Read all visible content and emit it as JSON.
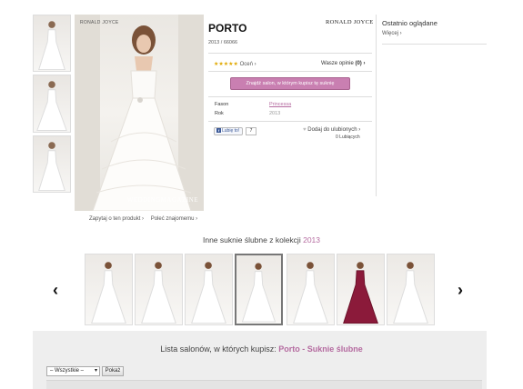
{
  "product": {
    "title": "PORTO",
    "code": "2013 / 66066",
    "brand": "RONALD JOYCE",
    "rate_label": "Oceń ›",
    "stars": "★★★★★",
    "reviews_label": "Wasze opinie",
    "reviews_count": "(0) ›",
    "salon_button": "Znajdź salon, w którym kupisz tę suknię",
    "attributes": [
      {
        "label": "Fason",
        "value": "Princessa"
      },
      {
        "label": "Rok",
        "value": "2013"
      }
    ],
    "like_label": "Lubię to!",
    "like_count": "7",
    "favorite_label": "Dodaj do ulubionych ›",
    "favorite_count": "0 Lubiących"
  },
  "photo": {
    "brand_tag": "RONALD JOYCE",
    "watermark": "WEDDINGMAGAZINE",
    "ask_link": "Zapytaj o ten produkt ›",
    "recommend_link": "Poleć znajomemu ›"
  },
  "sidebar": {
    "title": "Ostatnio oglądane",
    "more": "Więcej ›"
  },
  "collection": {
    "title": "Inne suknie ślubne z kolekcji",
    "year": "2013",
    "prev_icon": "‹",
    "next_icon": "›",
    "dresses": [
      "white",
      "white",
      "white",
      "white-active",
      "white",
      "burgundy",
      "white"
    ]
  },
  "salons": {
    "heading": "Lista salonów, w których kupisz:",
    "heading_link": "Porto - Suknie ślubne",
    "filter_value": "– Wszystkie –",
    "show_button": "Pokaż"
  }
}
